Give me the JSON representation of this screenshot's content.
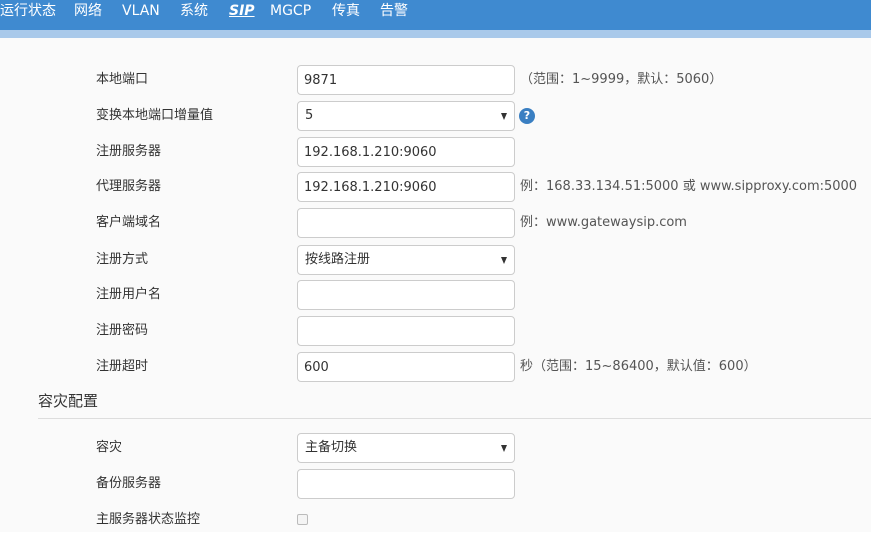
{
  "nav": {
    "items": [
      {
        "label": "运行状态"
      },
      {
        "label": "网络"
      },
      {
        "label": "VLAN"
      },
      {
        "label": "系统"
      },
      {
        "label": "SIP",
        "active": true
      },
      {
        "label": "MGCP"
      },
      {
        "label": "传真"
      },
      {
        "label": "告警"
      }
    ]
  },
  "form": {
    "local_port": {
      "label": "本地端口",
      "value": "9871",
      "hint": "（范围：1~9999，默认：5060）"
    },
    "port_increment": {
      "label": "变换本地端口增量值",
      "value": "5",
      "help_icon": "question-icon"
    },
    "register_server": {
      "label": "注册服务器",
      "value": "192.168.1.210:9060"
    },
    "proxy_server": {
      "label": "代理服务器",
      "value": "192.168.1.210:9060",
      "hint": "例：168.33.134.51:5000 或 www.sipproxy.com:5000"
    },
    "client_domain": {
      "label": "客户端域名",
      "value": "",
      "hint": "例：www.gatewaysip.com"
    },
    "register_mode": {
      "label": "注册方式",
      "value": "按线路注册"
    },
    "register_user": {
      "label": "注册用户名",
      "value": ""
    },
    "register_password": {
      "label": "注册密码",
      "value": ""
    },
    "register_timeout": {
      "label": "注册超时",
      "value": "600",
      "hint": "秒（范围：15~86400，默认值：600）"
    }
  },
  "disaster": {
    "section_title": "容灾配置",
    "mode": {
      "label": "容灾",
      "value": "主备切换"
    },
    "backup_server": {
      "label": "备份服务器",
      "value": ""
    },
    "monitor": {
      "label": "主服务器状态监控",
      "checked": false
    }
  },
  "colors": {
    "nav_bg": "#3f8ad0",
    "subbar": "#a9c9ea",
    "help_icon": "#3a7fc2"
  }
}
